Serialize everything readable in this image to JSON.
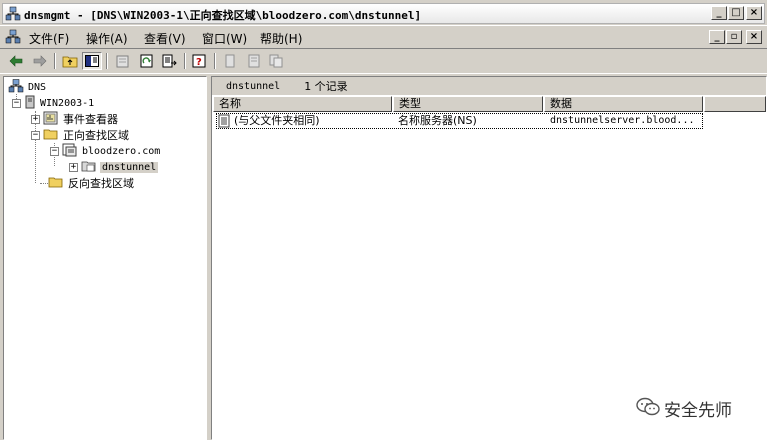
{
  "window": {
    "title": "dnsmgmt - [DNS\\WIN2003-1\\正向查找区域\\bloodzero.com\\dnstunnel]"
  },
  "menu": {
    "items": [
      {
        "label": "文件(F)"
      },
      {
        "label": "操作(A)"
      },
      {
        "label": "查看(V)"
      },
      {
        "label": "窗口(W)"
      },
      {
        "label": "帮助(H)"
      }
    ]
  },
  "toolbar": {
    "buttons": [
      "back-arrow-icon",
      "forward-arrow-icon",
      "up-folder-icon",
      "show-tree-icon",
      "properties-icon",
      "refresh-icon",
      "export-list-icon",
      "help-icon",
      "record-icon-1",
      "record-icon-2",
      "record-icon-3"
    ]
  },
  "tree": {
    "root": "DNS",
    "server": "WIN2003-1",
    "event_viewer": "事件查看器",
    "forward_zones": "正向查找区域",
    "zone": "bloodzero.com",
    "subdomain": "dnstunnel",
    "reverse_zones": "反向查找区域"
  },
  "details": {
    "header_name": "dnstunnel",
    "header_count": "1 个记录",
    "columns": [
      "名称",
      "类型",
      "数据"
    ],
    "rows": [
      {
        "name": "(与父文件夹相同)",
        "type": "名称服务器(NS)",
        "data": "dnstunnelserver.blood..."
      }
    ]
  },
  "watermark": {
    "text": "安全先师"
  },
  "colors": {
    "chrome": "#d4d0c8",
    "selection": "#d4d0c8"
  }
}
